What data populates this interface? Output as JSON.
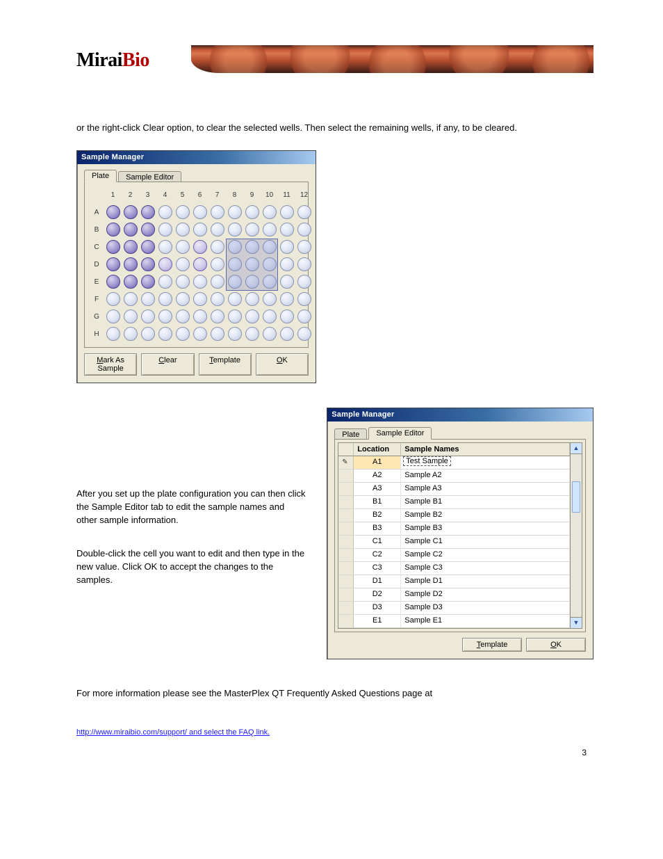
{
  "logo": {
    "left": "Mirai",
    "right": "Bio"
  },
  "intro_text": "or the right-click Clear option, to clear the selected wells. Then select the remaining wells, if any, to be cleared.",
  "para_right_1": "After you set up the plate configuration you can then click the Sample Editor tab to edit the sample names and other sample information.",
  "para_right_2": "Double-click the cell you want to edit and then type in the new value. Click OK to accept the changes to the samples.",
  "outro_text": "For more information please see the MasterPlex QT Frequently Asked Questions page at",
  "outro_link": "http://www.miraibio.com/support/ and select the FAQ link.",
  "page_number": "3",
  "dialog1": {
    "title": "Sample Manager",
    "tabs": {
      "plate": "Plate",
      "editor": "Sample Editor"
    },
    "cols": [
      "1",
      "2",
      "3",
      "4",
      "5",
      "6",
      "7",
      "8",
      "9",
      "10",
      "11",
      "12"
    ],
    "rows": [
      "A",
      "B",
      "C",
      "D",
      "E",
      "F",
      "G",
      "H"
    ],
    "buttons": {
      "mark": "Mark As Sample",
      "clear": "Clear",
      "template": "Template",
      "ok": "OK"
    }
  },
  "dialog2": {
    "title": "Sample Manager",
    "tabs": {
      "plate": "Plate",
      "editor": "Sample Editor"
    },
    "headers": {
      "loc": "Location",
      "name": "Sample Names"
    },
    "rows": [
      {
        "loc": "A1",
        "name": "Test Sample",
        "editing": true
      },
      {
        "loc": "A2",
        "name": "Sample A2"
      },
      {
        "loc": "A3",
        "name": "Sample A3"
      },
      {
        "loc": "B1",
        "name": "Sample B1"
      },
      {
        "loc": "B2",
        "name": "Sample B2"
      },
      {
        "loc": "B3",
        "name": "Sample B3"
      },
      {
        "loc": "C1",
        "name": "Sample C1"
      },
      {
        "loc": "C2",
        "name": "Sample C2"
      },
      {
        "loc": "C3",
        "name": "Sample C3"
      },
      {
        "loc": "D1",
        "name": "Sample D1"
      },
      {
        "loc": "D2",
        "name": "Sample D2"
      },
      {
        "loc": "D3",
        "name": "Sample D3"
      },
      {
        "loc": "E1",
        "name": "Sample E1"
      }
    ],
    "buttons": {
      "template": "Template",
      "ok": "OK"
    }
  },
  "plate_state": {
    "selected": [
      "A1",
      "A2",
      "A3",
      "B1",
      "B2",
      "B3",
      "C1",
      "C2",
      "C3",
      "D1",
      "D2",
      "D3",
      "E1",
      "E2",
      "E3"
    ],
    "mid": [
      "C6",
      "D6",
      "D4"
    ],
    "rect": {
      "row_start": 2,
      "col_start": 7,
      "rows": 3,
      "cols": 3
    }
  }
}
